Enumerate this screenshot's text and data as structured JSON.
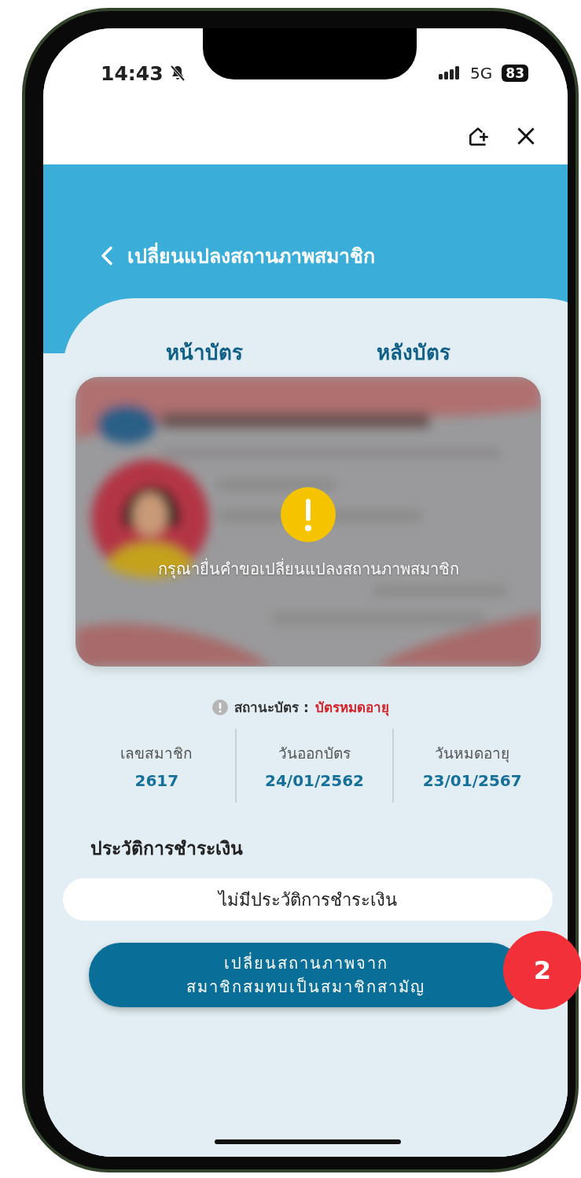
{
  "status_bar": {
    "time": "14:43",
    "network": "5G",
    "battery": "83"
  },
  "header": {
    "title": "เปลี่ยนแปลงสถานภาพสมาชิก"
  },
  "tabs": [
    {
      "label": "หน้าบัตร"
    },
    {
      "label": "หลังบัตร"
    }
  ],
  "card": {
    "kind": "picture",
    "message": "กรุณายื่นคำขอเปลี่ยนแปลงสถานภาพสมาชิก"
  },
  "card_status": {
    "label": "สถานะบัตร :",
    "value": "บัตรหมดอายุ"
  },
  "details": [
    {
      "label": "เลขสมาชิก",
      "value": "2617"
    },
    {
      "label": "วันออกบัตร",
      "value": "24/01/2562"
    },
    {
      "label": "วันหมดอายุ",
      "value": "23/01/2567"
    }
  ],
  "payment_history": {
    "title": "ประวัติการชำระเงิน",
    "empty_text": "ไม่มีประวัติการชำระเงิน"
  },
  "action_button": {
    "lines": [
      "เปลี่ยนสถานภาพจาก",
      "สมาชิกสมทบเป็นสมาชิกสามัญ"
    ]
  },
  "step_badge": "2"
}
